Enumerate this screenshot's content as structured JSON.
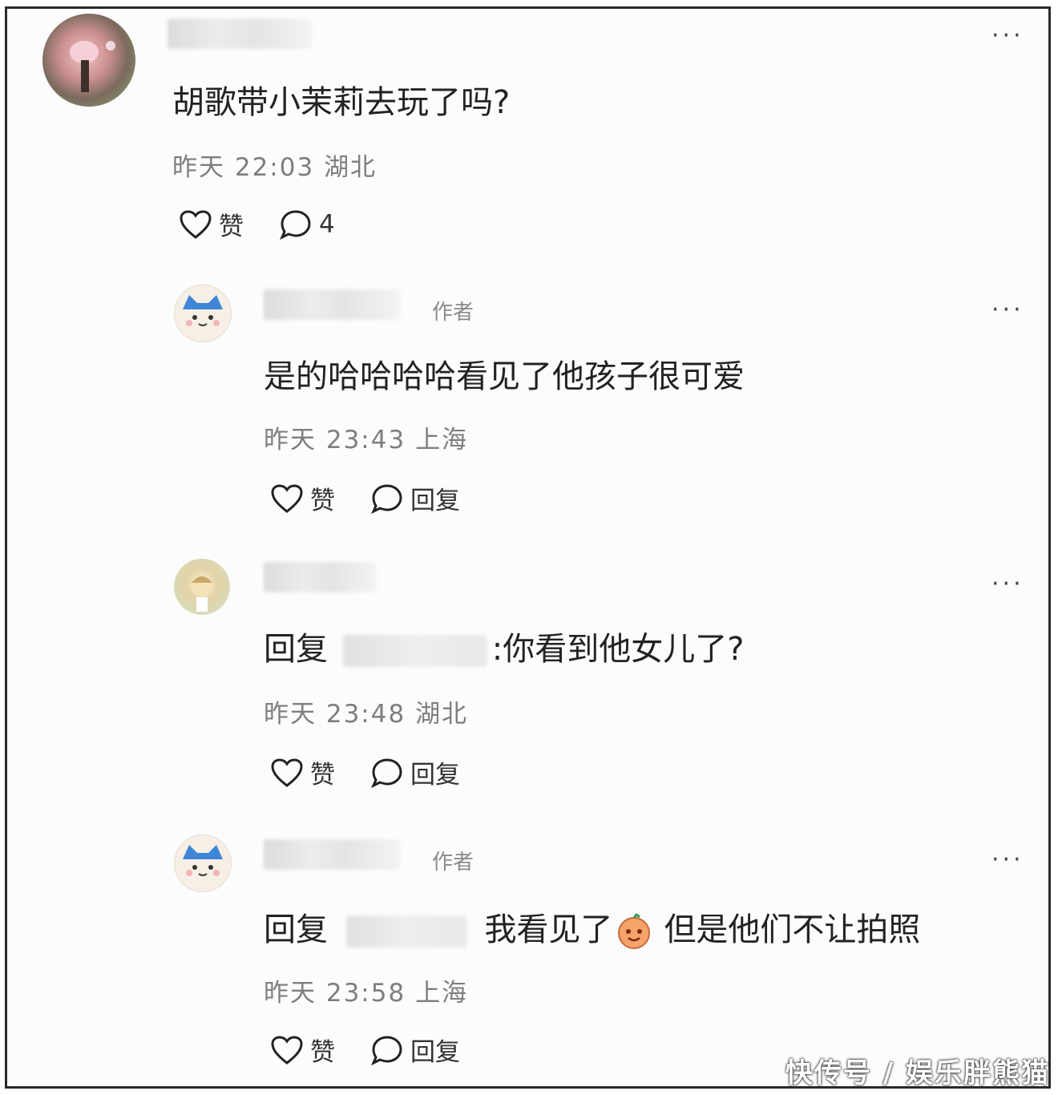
{
  "root_comment": {
    "text": "胡歌带小茉莉去玩了吗?",
    "time": "昨天 22:03",
    "location": "湖北",
    "like_label": "赞",
    "reply_count": "4",
    "more": "···"
  },
  "replies": [
    {
      "author_tag": "作者",
      "text": "是的哈哈哈哈看见了他孩子很可爱",
      "time": "昨天 23:43",
      "location": "上海",
      "like_label": "赞",
      "reply_label": "回复",
      "more": "···"
    },
    {
      "reply_prefix": "回复",
      "text": ":你看到他女儿了?",
      "time": "昨天 23:48",
      "location": "湖北",
      "like_label": "赞",
      "reply_label": "回复",
      "more": "···"
    },
    {
      "author_tag": "作者",
      "reply_prefix": "回复",
      "text_a": "我看见了",
      "text_b": "但是他们不让拍照",
      "time": "昨天 23:58",
      "location": "上海",
      "like_label": "赞",
      "reply_label": "回复",
      "more": "···"
    }
  ],
  "watermark": "快传号 / 娱乐胖熊猫"
}
